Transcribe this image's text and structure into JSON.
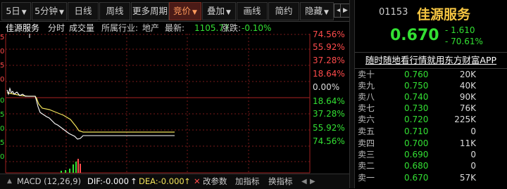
{
  "toolbar": {
    "nav_left": "◀",
    "nav_right": "▶",
    "buttons": [
      {
        "label": "5日",
        "caret": "▼"
      },
      {
        "label": "5分钟",
        "caret": "▼"
      },
      {
        "label": "日线"
      },
      {
        "label": "周线"
      },
      {
        "label": "更多周期"
      },
      {
        "label": "竞价",
        "caret": "▼"
      },
      {
        "label": "叠加",
        "caret": "▼"
      },
      {
        "label": "画线"
      },
      {
        "label": "简约"
      },
      {
        "label": "隐藏",
        "caret": "▼"
      }
    ]
  },
  "infobar": {
    "name": "佳源服务",
    "period": "分时",
    "volume": "成交量",
    "industry_label": "所属行业:",
    "industry": "地产",
    "latest_label": "最新:",
    "latest": "1105.77",
    "change_label": "涨跌:",
    "change": "-0.10%"
  },
  "chart": {
    "axis_right": [
      "74.56%",
      "55.92%",
      "37.28%",
      "18.64%",
      "0.00%",
      "18.64%",
      "37.28%",
      "55.92%",
      "74.56%"
    ],
    "left_tick_marks": [
      "5",
      "0",
      "5",
      "0",
      "5",
      "0",
      "5",
      "0",
      "5",
      "0"
    ]
  },
  "bottom": {
    "indicator": "MACD (12,26,9)",
    "dif": "DIF:-0.000",
    "dea": "DEA:-0.000",
    "arrow": "↑",
    "x_mark": "✕",
    "params": "改参数",
    "add": "加指标",
    "switch": "换指标"
  },
  "quote": {
    "code": "01153",
    "name": "佳源服务",
    "price": "0.670",
    "change": "- 1.610",
    "change_pct": "- 70.61%",
    "ad": "随时随地看行情就用东方财富APP",
    "asks": [
      {
        "label": "卖十",
        "price": "0.760",
        "vol": "20K"
      },
      {
        "label": "卖九",
        "price": "0.750",
        "vol": "40K"
      },
      {
        "label": "卖八",
        "price": "0.740",
        "vol": "90K"
      },
      {
        "label": "卖七",
        "price": "0.730",
        "vol": "76K"
      },
      {
        "label": "卖六",
        "price": "0.720",
        "vol": "225K"
      },
      {
        "label": "卖五",
        "price": "0.710",
        "vol": "0"
      },
      {
        "label": "卖四",
        "price": "0.700",
        "vol": "11K"
      },
      {
        "label": "卖三",
        "price": "0.690",
        "vol": "0"
      },
      {
        "label": "卖二",
        "price": "0.680",
        "vol": "0"
      },
      {
        "label": "卖一",
        "price": "0.670",
        "vol": "57K"
      }
    ]
  },
  "colors": {
    "up": "#ff4b4b",
    "down": "#33e033",
    "price_line": "#ffffff",
    "avg_line": "#f2e35a",
    "active_button": "#ff9a5c"
  }
}
